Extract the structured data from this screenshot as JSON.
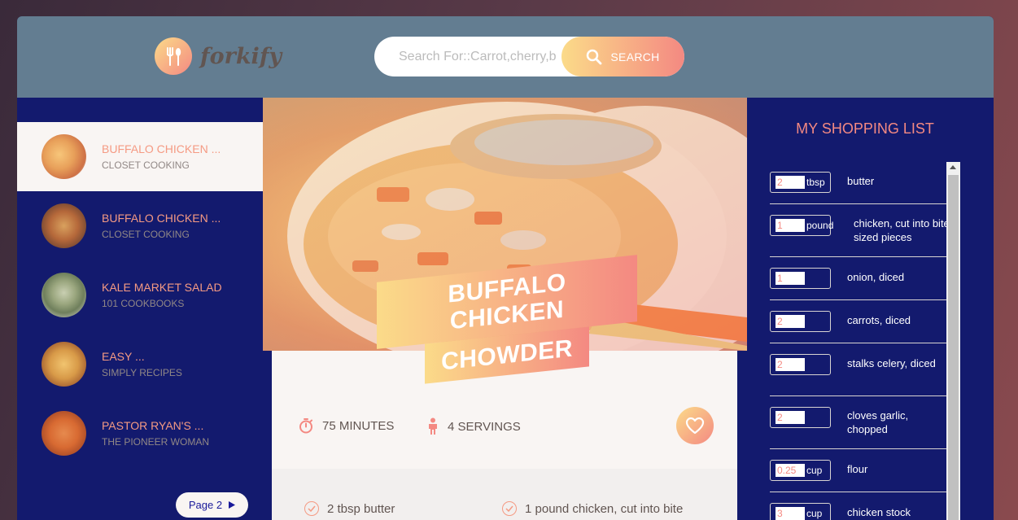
{
  "header": {
    "logo_text": "forkify",
    "search_placeholder": "Search For::Carrot,cherry,b",
    "search_button": "SEARCH"
  },
  "results": [
    {
      "title": "BUFFALO CHICKEN ...",
      "author": "CLOSET COOKING",
      "active": true
    },
    {
      "title": "BUFFALO CHICKEN ...",
      "author": "CLOSET COOKING",
      "active": false
    },
    {
      "title": "KALE MARKET SALAD",
      "author": "101 COOKBOOKS",
      "active": false
    },
    {
      "title": "EASY ...",
      "author": "SIMPLY RECIPES",
      "active": false
    },
    {
      "title": "PASTOR RYAN'S ...",
      "author": "THE PIONEER WOMAN",
      "active": false
    }
  ],
  "pagination": {
    "label": "Page 2"
  },
  "recipe": {
    "title_line1": "BUFFALO CHICKEN",
    "title_line2": "CHOWDER",
    "time": "75",
    "time_unit": "MINUTES",
    "servings": "4",
    "servings_unit": "SERVINGS",
    "ingredients": [
      "2 tbsp butter",
      "1 pound chicken, cut into bite"
    ]
  },
  "shopping": {
    "title": "MY SHOPPING LIST",
    "items": [
      {
        "qty": "2",
        "unit": "tbsp",
        "desc": "butter"
      },
      {
        "qty": "1",
        "unit": "pound",
        "desc": "chicken, cut into bite sized pieces"
      },
      {
        "qty": "1",
        "unit": "",
        "desc": "onion, diced"
      },
      {
        "qty": "2",
        "unit": "",
        "desc": "carrots, diced"
      },
      {
        "qty": "2",
        "unit": "",
        "desc": "stalks celery, diced"
      },
      {
        "qty": "2",
        "unit": "",
        "desc": "cloves garlic, chopped"
      },
      {
        "qty": "0.25",
        "unit": "cup",
        "desc": "flour"
      },
      {
        "qty": "3",
        "unit": "cup",
        "desc": "chicken stock"
      }
    ]
  },
  "colors": {
    "accent_start": "#fbdb89",
    "accent_end": "#f48982",
    "panel": "#131a6e",
    "header": "#637d91"
  }
}
